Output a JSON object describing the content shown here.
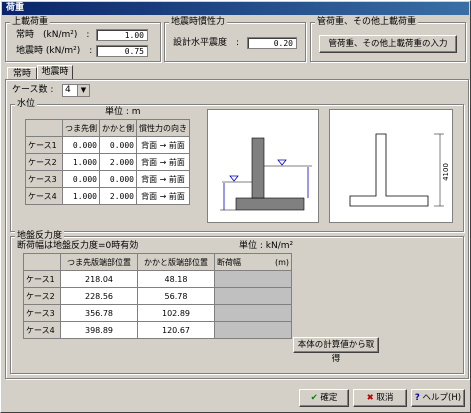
{
  "window": {
    "title": "荷重"
  },
  "upper_load": {
    "title": "上載荷重",
    "normal_label": "常時　(kN/m²)　:",
    "normal_value": "1.00",
    "quake_label": "地震時 (kN/m²)　:",
    "quake_value": "0.75"
  },
  "seismic_inertia": {
    "title": "地震時慣性力",
    "coef_label": "設計水平震度　:",
    "coef_value": "0.20"
  },
  "pipe_load": {
    "title": "管荷重、その他上載荷重",
    "button_label": "管荷重、その他上載荷重の入力"
  },
  "tabs": [
    {
      "label": "常時"
    },
    {
      "label": "地震時"
    }
  ],
  "case_count": {
    "label": "ケース数 :",
    "value": "4"
  },
  "water": {
    "title": "水位",
    "unit": "単位 : m",
    "headers": [
      "",
      "つま先側",
      "かかと側",
      "慣性力の向き"
    ],
    "rows": [
      {
        "case": "ケース1",
        "toe": "0.000",
        "heel": "0.000",
        "dir": "背面 → 前面"
      },
      {
        "case": "ケース2",
        "toe": "1.000",
        "heel": "2.000",
        "dir": "背面 → 前面"
      },
      {
        "case": "ケース3",
        "toe": "0.000",
        "heel": "0.000",
        "dir": "背面 → 前面"
      },
      {
        "case": "ケース4",
        "toe": "1.000",
        "heel": "2.000",
        "dir": "背面 → 前面"
      }
    ],
    "dim_label": "4100"
  },
  "ground": {
    "title": "地盤反力度",
    "note": "断荷幅は地盤反力度=0時有効",
    "unit": "単位 : kN/m²",
    "headers": [
      "",
      "つま先版端部位置",
      "かかと版端部位置",
      "断荷幅",
      "(m)"
    ],
    "rows": [
      {
        "case": "ケース1",
        "toe": "218.04",
        "heel": "48.18"
      },
      {
        "case": "ケース2",
        "toe": "228.56",
        "heel": "56.78"
      },
      {
        "case": "ケース3",
        "toe": "356.78",
        "heel": "102.89"
      },
      {
        "case": "ケース4",
        "toe": "398.89",
        "heel": "120.67"
      }
    ],
    "fetch_button": "本体の計算値から取得"
  },
  "footer": {
    "ok": "確定",
    "cancel": "取消",
    "help": "ヘルプ(H)"
  },
  "colors": {
    "title_bar": "#0a246a",
    "face": "#d4d0c8",
    "ok_check": "#008000",
    "cancel_x": "#c00000"
  }
}
